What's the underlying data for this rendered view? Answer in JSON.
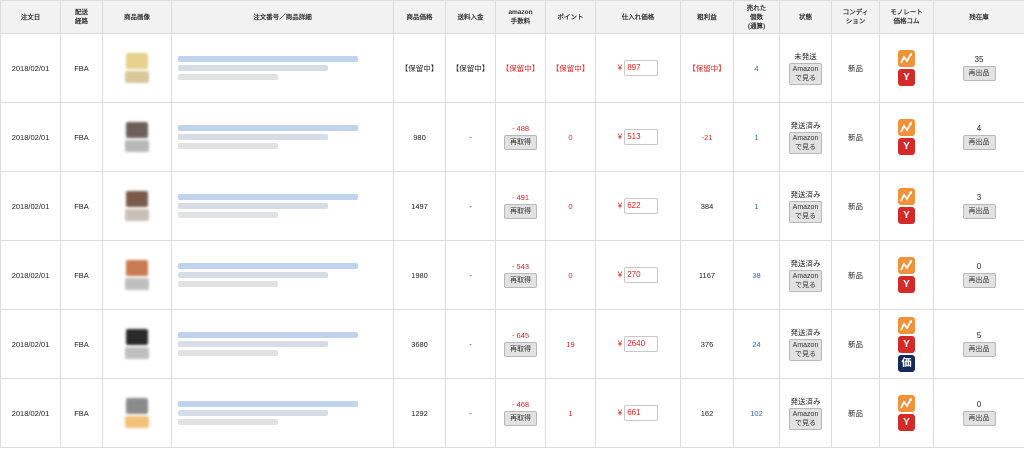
{
  "header": {
    "order_date": "注文日",
    "shipping_route": "配送\n経路",
    "product_image": "商品画像",
    "order_detail": "注文番号／商品詳細",
    "product_price": "商品価格",
    "shipping_fee": "送料入金",
    "amazon_fee": "amazon\n手数料",
    "points": "ポイント",
    "purchase_price": "仕入れ価格",
    "gross_profit": "粗利益",
    "sold_count": "売れた\n個数\n(通算)",
    "status": "状態",
    "condition": "コンディ\nション",
    "monorate": "モノレート\n価格コム",
    "stock": "残在庫"
  },
  "labels": {
    "refetch": "再取得",
    "view_amazon": "Amazon\nで見る",
    "relist": "再出品",
    "yen": "¥",
    "yahoo_glyph": "Y",
    "price_glyph": "価"
  },
  "icons": {
    "monorate": "monorate-chart-icon",
    "yahoo": "yahoo-icon",
    "kakaku": "kakaku-price-icon"
  },
  "colors": {
    "accent_red": "#e02020",
    "link_blue": "#2a6ac8",
    "monorate_orange": "#f0923a",
    "yahoo_red": "#d42a2a",
    "kakaku_navy": "#152a5a"
  },
  "rows": [
    {
      "date": "2018/02/01",
      "route": "FBA",
      "price": "【保留中】",
      "shipping": "【保留中】",
      "fee": "【保留中】",
      "fee_refetch": false,
      "points": "【保留中】",
      "purchase": "897",
      "profit": "【保留中】",
      "sold": "4",
      "status": "未発送",
      "condition": "新品",
      "has_kakaku": false,
      "stock": "35",
      "img_colors": [
        "#e6d28c",
        "#d8c89a"
      ]
    },
    {
      "date": "2018/02/01",
      "route": "FBA",
      "price": "980",
      "shipping": "-",
      "fee": "- 488",
      "fee_refetch": true,
      "points": "0",
      "purchase": "513",
      "profit": "-21",
      "sold": "1",
      "status": "発送済み",
      "condition": "新品",
      "has_kakaku": false,
      "stock": "4",
      "img_colors": [
        "#6b5f58",
        "#b8b8b8"
      ]
    },
    {
      "date": "2018/02/01",
      "route": "FBA",
      "price": "1497",
      "shipping": "-",
      "fee": "- 491",
      "fee_refetch": true,
      "points": "0",
      "purchase": "622",
      "profit": "384",
      "sold": "1",
      "status": "発送済み",
      "condition": "新品",
      "has_kakaku": false,
      "stock": "3",
      "img_colors": [
        "#7a5a48",
        "#c8c0b8"
      ]
    },
    {
      "date": "2018/02/01",
      "route": "FBA",
      "price": "1980",
      "shipping": "-",
      "fee": "- 543",
      "fee_refetch": true,
      "points": "0",
      "purchase": "270",
      "profit": "1167",
      "sold": "38",
      "status": "発送済み",
      "condition": "新品",
      "has_kakaku": false,
      "stock": "0",
      "img_colors": [
        "#c87a50",
        "#bfbfbf"
      ]
    },
    {
      "date": "2018/02/01",
      "route": "FBA",
      "price": "3680",
      "shipping": "-",
      "fee": "- 645",
      "fee_refetch": true,
      "points": "19",
      "purchase": "2640",
      "profit": "376",
      "sold": "24",
      "status": "発送済み",
      "condition": "新品",
      "has_kakaku": true,
      "stock": "5",
      "img_colors": [
        "#2a2a2a",
        "#c0c0c0"
      ]
    },
    {
      "date": "2018/02/01",
      "route": "FBA",
      "price": "1292",
      "shipping": "-",
      "fee": "- 468",
      "fee_refetch": true,
      "points": "1",
      "purchase": "661",
      "profit": "162",
      "sold": "102",
      "status": "発送済み",
      "condition": "新品",
      "has_kakaku": false,
      "stock": "0",
      "img_colors": [
        "#8a8a8a",
        "#f2c27a"
      ]
    }
  ]
}
